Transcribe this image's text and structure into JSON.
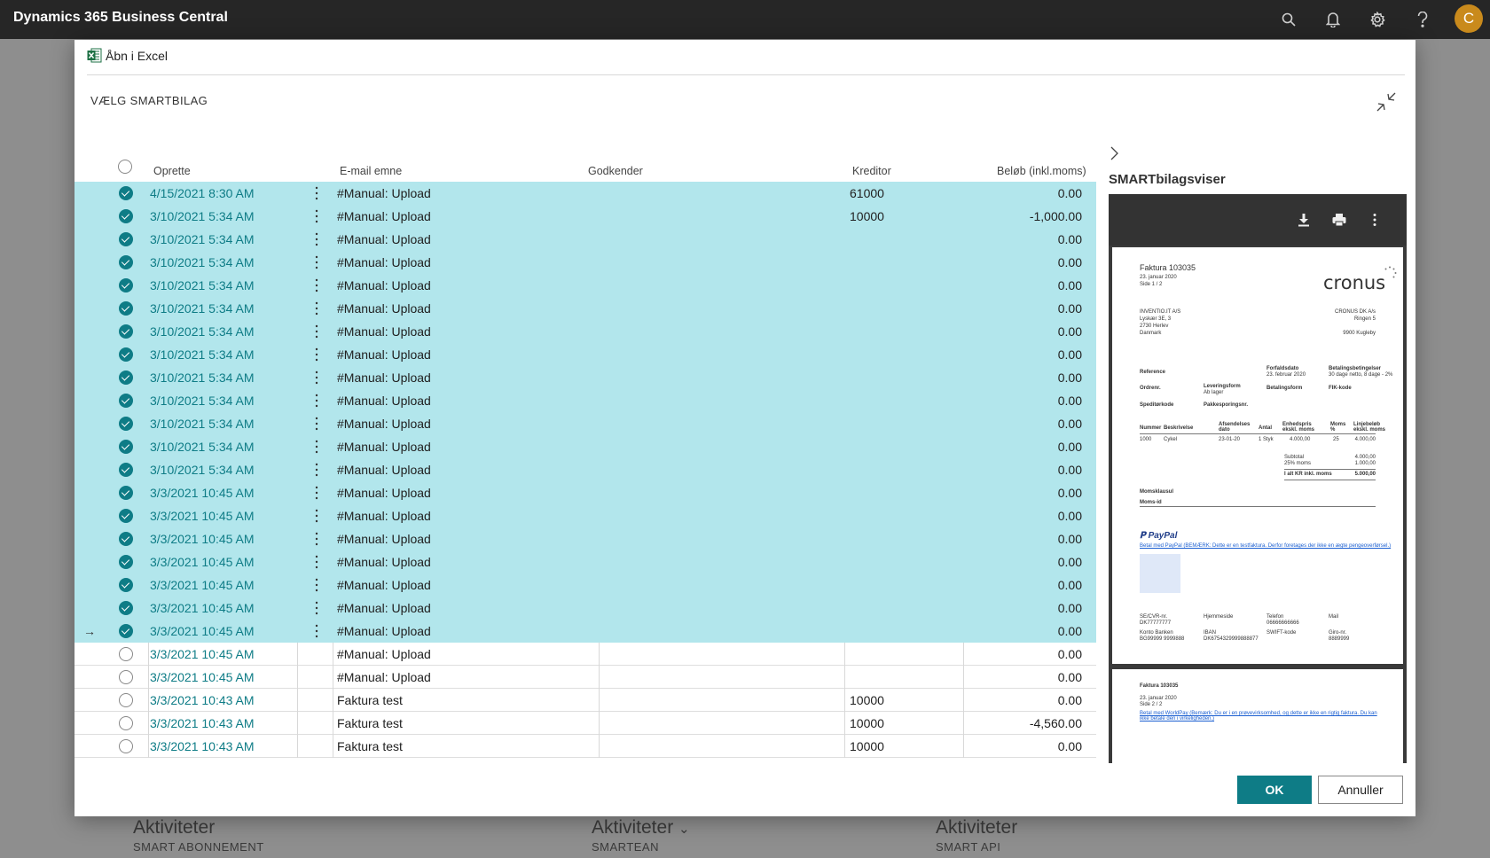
{
  "app_title": "Dynamics 365 Business Central",
  "topbar": {
    "avatar_letter": "C"
  },
  "modal": {
    "open_excel_label": "Åbn i Excel",
    "caption": "VÆLG SMARTBILAG",
    "columns": {
      "created": "Oprette",
      "subject": "E-mail emne",
      "approver": "Godkender",
      "creditor": "Kreditor",
      "amount": "Beløb (inkl.moms)"
    },
    "rows": [
      {
        "selected": true,
        "current": false,
        "date": "4/15/2021 8:30 AM",
        "subject": "#Manual: Upload",
        "creditor": "61000",
        "amount": "0.00"
      },
      {
        "selected": true,
        "current": false,
        "date": "3/10/2021 5:34 AM",
        "subject": "#Manual: Upload",
        "creditor": "10000",
        "amount": "-1,000.00"
      },
      {
        "selected": true,
        "current": false,
        "date": "3/10/2021 5:34 AM",
        "subject": "#Manual: Upload",
        "creditor": "",
        "amount": "0.00"
      },
      {
        "selected": true,
        "current": false,
        "date": "3/10/2021 5:34 AM",
        "subject": "#Manual: Upload",
        "creditor": "",
        "amount": "0.00"
      },
      {
        "selected": true,
        "current": false,
        "date": "3/10/2021 5:34 AM",
        "subject": "#Manual: Upload",
        "creditor": "",
        "amount": "0.00"
      },
      {
        "selected": true,
        "current": false,
        "date": "3/10/2021 5:34 AM",
        "subject": "#Manual: Upload",
        "creditor": "",
        "amount": "0.00"
      },
      {
        "selected": true,
        "current": false,
        "date": "3/10/2021 5:34 AM",
        "subject": "#Manual: Upload",
        "creditor": "",
        "amount": "0.00"
      },
      {
        "selected": true,
        "current": false,
        "date": "3/10/2021 5:34 AM",
        "subject": "#Manual: Upload",
        "creditor": "",
        "amount": "0.00"
      },
      {
        "selected": true,
        "current": false,
        "date": "3/10/2021 5:34 AM",
        "subject": "#Manual: Upload",
        "creditor": "",
        "amount": "0.00"
      },
      {
        "selected": true,
        "current": false,
        "date": "3/10/2021 5:34 AM",
        "subject": "#Manual: Upload",
        "creditor": "",
        "amount": "0.00"
      },
      {
        "selected": true,
        "current": false,
        "date": "3/10/2021 5:34 AM",
        "subject": "#Manual: Upload",
        "creditor": "",
        "amount": "0.00"
      },
      {
        "selected": true,
        "current": false,
        "date": "3/10/2021 5:34 AM",
        "subject": "#Manual: Upload",
        "creditor": "",
        "amount": "0.00"
      },
      {
        "selected": true,
        "current": false,
        "date": "3/10/2021 5:34 AM",
        "subject": "#Manual: Upload",
        "creditor": "",
        "amount": "0.00"
      },
      {
        "selected": true,
        "current": false,
        "date": "3/3/2021 10:45 AM",
        "subject": "#Manual: Upload",
        "creditor": "",
        "amount": "0.00"
      },
      {
        "selected": true,
        "current": false,
        "date": "3/3/2021 10:45 AM",
        "subject": "#Manual: Upload",
        "creditor": "",
        "amount": "0.00"
      },
      {
        "selected": true,
        "current": false,
        "date": "3/3/2021 10:45 AM",
        "subject": "#Manual: Upload",
        "creditor": "",
        "amount": "0.00"
      },
      {
        "selected": true,
        "current": false,
        "date": "3/3/2021 10:45 AM",
        "subject": "#Manual: Upload",
        "creditor": "",
        "amount": "0.00"
      },
      {
        "selected": true,
        "current": false,
        "date": "3/3/2021 10:45 AM",
        "subject": "#Manual: Upload",
        "creditor": "",
        "amount": "0.00"
      },
      {
        "selected": true,
        "current": false,
        "date": "3/3/2021 10:45 AM",
        "subject": "#Manual: Upload",
        "creditor": "",
        "amount": "0.00"
      },
      {
        "selected": true,
        "current": true,
        "date": "3/3/2021 10:45 AM",
        "subject": "#Manual: Upload",
        "creditor": "",
        "amount": "0.00"
      },
      {
        "selected": false,
        "current": false,
        "date": "3/3/2021 10:45 AM",
        "subject": "#Manual: Upload",
        "creditor": "",
        "amount": "0.00"
      },
      {
        "selected": false,
        "current": false,
        "date": "3/3/2021 10:45 AM",
        "subject": "#Manual: Upload",
        "creditor": "",
        "amount": "0.00"
      },
      {
        "selected": false,
        "current": false,
        "date": "3/3/2021 10:43 AM",
        "subject": "Faktura test",
        "creditor": "10000",
        "amount": "0.00"
      },
      {
        "selected": false,
        "current": false,
        "date": "3/3/2021 10:43 AM",
        "subject": "Faktura test",
        "creditor": "10000",
        "amount": "-4,560.00"
      },
      {
        "selected": false,
        "current": false,
        "date": "3/3/2021 10:43 AM",
        "subject": "Faktura test",
        "creditor": "10000",
        "amount": "0.00"
      }
    ],
    "side_panel": {
      "title": "SMARTbilagsviser",
      "page1": {
        "invoice_title": "Faktura 103035",
        "invoice_date": "23. januar 2020",
        "page_no": "Side 1 / 2",
        "logo": "cronus",
        "sender": [
          "INVENTIO.IT A/S",
          "Lyskær 3E, 3",
          "2730 Herlev",
          "Danmark"
        ],
        "recipient": [
          "CRONUS DK A/s",
          "Ringen 5",
          "",
          "9900 Kugleby"
        ],
        "reference_label": "Reference",
        "due_label": "Forfaldsdato",
        "due_value": "23. februar 2020",
        "terms_label": "Betalingsbetingelser",
        "terms_value": "30 dage netto, 8 dage - 2%",
        "order_label": "Ordrenr.",
        "delivery_label": "Leveringsform",
        "delivery_value": "Ab lager",
        "payment_label": "Betalingsform",
        "fik_label": "FIK-kode",
        "shipper_label": "Speditørkode",
        "packages_label": "Pakkesporingsnr.",
        "line_headers": [
          "Nummer",
          "Beskrivelse",
          "Afsendelses dato",
          "Antal",
          "Enhedspris ekskl. moms",
          "Moms %",
          "Linjebeløb ekskl. moms"
        ],
        "line": [
          "1000",
          "Cykel",
          "23-01-20",
          "1 Styk",
          "4.000,00",
          "25",
          "4.000,00"
        ],
        "subtotal_label": "Subtotal",
        "subtotal_value": "4.000,00",
        "vat_label": "25% moms",
        "vat_value": "1.000,00",
        "total_label": "I alt KR inkl. moms",
        "total_value": "5.000,00",
        "vat_reg_label": "Momsklausul",
        "vat_id_label": "Moms-id",
        "paypal": "PayPal",
        "paypal_link": "Betal med PayPal (BEMÆRK: Dette er en testfaktura. Derfor foretages der ikke en ægte pengeoverførsel.)",
        "footer_labels": [
          "SE/CVR-nr.",
          "Hjemmeside",
          "Telefon",
          "Mail"
        ],
        "footer_values": [
          "DK77777777",
          "",
          "06666666666",
          ""
        ],
        "footer_labels2": [
          "Konto Banken",
          "IBAN",
          "SWIFT-kode",
          "Giro-nr."
        ],
        "footer_values2": [
          "BG99999 9999888",
          "DK6754329999888877",
          "",
          "8889999"
        ]
      },
      "page2": {
        "invoice_title": "Faktura 103035",
        "invoice_date": "23. januar 2020",
        "page_no": "Side 2 / 2",
        "link": "Betal med WorldPay (Bemærk: Du er i en prøvevirksomhed, og dette er ikke en rigtig faktura. Du kan ikke betale den i virkeligheden.)"
      }
    },
    "ok_label": "OK",
    "cancel_label": "Annuller"
  },
  "background": {
    "cards": [
      {
        "title": "Aktiviteter",
        "subtitle": "SMART ABONNEMENT"
      },
      {
        "title": "Aktiviteter",
        "subtitle": "SMARTEAN"
      },
      {
        "title": "Aktiviteter",
        "subtitle": "SMART API"
      }
    ]
  },
  "colors": {
    "accent": "#0e7c86",
    "selection": "#b2e6ec",
    "topbar": "#262626"
  }
}
